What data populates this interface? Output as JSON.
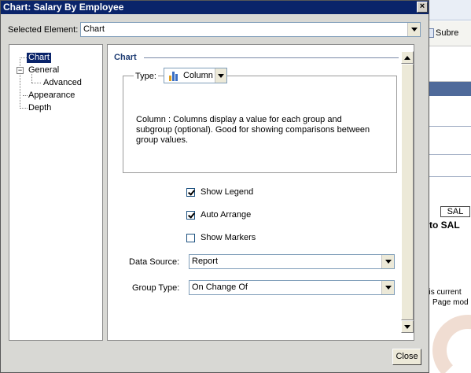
{
  "dialog": {
    "title": "Chart: Salary By Employee",
    "close_glyph": "×",
    "selected_element_label": "Selected Element:",
    "selected_element_value": "Chart",
    "close_button": "Close"
  },
  "tree": {
    "items": [
      {
        "label": "Chart"
      },
      {
        "label": "General",
        "expander": "−"
      },
      {
        "label": "Advanced"
      },
      {
        "label": "Appearance"
      },
      {
        "label": "Depth"
      }
    ]
  },
  "panel": {
    "section_title": "Chart",
    "type_label": "Type:",
    "type_value": "Column",
    "type_icon": "column-chart-icon",
    "description": "Column : Columns display a value for each group and subgroup (optional). Good for showing comparisons between group values.",
    "checkboxes": [
      {
        "label": "Show Legend",
        "checked": true
      },
      {
        "label": "Auto Arrange",
        "checked": true
      },
      {
        "label": "Show Markers",
        "checked": false
      }
    ],
    "data_source_label": "Data Source:",
    "data_source_value": "Report",
    "group_type_label": "Group Type:",
    "group_type_value": "On Change Of"
  },
  "background_app": {
    "toolbar_button": "Subre",
    "cell_text": "SAL",
    "bold_text": "to SAL",
    "message_line1": "t is current",
    "message_line2": "Page mod"
  },
  "colors": {
    "titlebar": "#0a246a",
    "selection": "#0a246a",
    "section_title": "#1f3d74"
  }
}
